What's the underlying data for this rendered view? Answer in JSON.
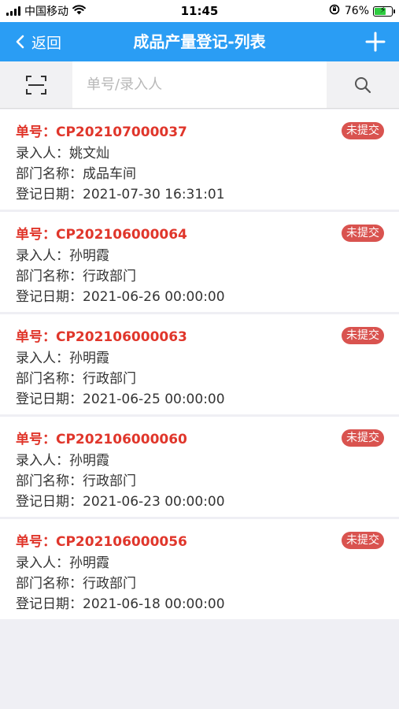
{
  "status_bar": {
    "carrier": "中国移动",
    "time": "11:45",
    "battery_percent": "76%",
    "battery_level": 0.76,
    "signal_bars": 4
  },
  "nav": {
    "back_label": "返回",
    "title": "成品产量登记-列表",
    "add_icon": "plus-icon"
  },
  "search": {
    "placeholder": "单号/录入人",
    "value": "",
    "scan_icon": "scan-icon",
    "search_icon": "search-icon"
  },
  "colors": {
    "nav_bg": "#2a9df4",
    "order_text": "#e0362b",
    "badge_bg": "#d9534f",
    "page_bg": "#efeff4"
  },
  "records": [
    {
      "order_label": "单号：",
      "order_no": "CP202107000037",
      "entry_label": "录入人：",
      "entry_person": "姚文灿",
      "dept_label": "部门名称：",
      "dept": "成品车间",
      "date_label": "登记日期：",
      "date": "2021-07-30 16:31:01",
      "status": "未提交"
    },
    {
      "order_label": "单号：",
      "order_no": "CP202106000064",
      "entry_label": "录入人：",
      "entry_person": "孙明霞",
      "dept_label": "部门名称：",
      "dept": "行政部门",
      "date_label": "登记日期：",
      "date": "2021-06-26 00:00:00",
      "status": "未提交"
    },
    {
      "order_label": "单号：",
      "order_no": "CP202106000063",
      "entry_label": "录入人：",
      "entry_person": "孙明霞",
      "dept_label": "部门名称：",
      "dept": "行政部门",
      "date_label": "登记日期：",
      "date": "2021-06-25 00:00:00",
      "status": "未提交"
    },
    {
      "order_label": "单号：",
      "order_no": "CP202106000060",
      "entry_label": "录入人：",
      "entry_person": "孙明霞",
      "dept_label": "部门名称：",
      "dept": "行政部门",
      "date_label": "登记日期：",
      "date": "2021-06-23 00:00:00",
      "status": "未提交"
    },
    {
      "order_label": "单号：",
      "order_no": "CP202106000056",
      "entry_label": "录入人：",
      "entry_person": "孙明霞",
      "dept_label": "部门名称：",
      "dept": "行政部门",
      "date_label": "登记日期：",
      "date": "2021-06-18 00:00:00",
      "status": "未提交"
    }
  ]
}
